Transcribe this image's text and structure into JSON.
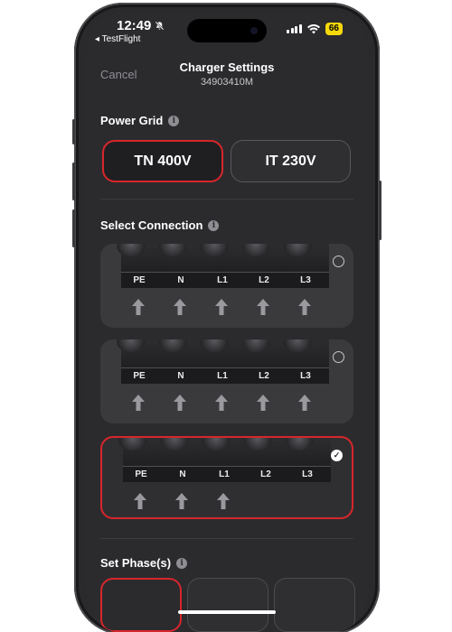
{
  "status_bar": {
    "time": "12:49",
    "mute_icon": "bell-slash-icon",
    "back_app": "◂ TestFlight",
    "battery": "66",
    "battery_color": "#f5d90a"
  },
  "header": {
    "cancel_label": "Cancel",
    "title": "Charger Settings",
    "subtitle": "34903410M"
  },
  "power_grid": {
    "label": "Power Grid",
    "options": [
      {
        "label": "TN 400V",
        "selected": true
      },
      {
        "label": "IT 230V",
        "selected": false
      }
    ]
  },
  "select_connection": {
    "label": "Select Connection",
    "terminals": [
      "PE",
      "N",
      "L1",
      "L2",
      "L3"
    ],
    "options": [
      {
        "arrows": 5,
        "selected": false
      },
      {
        "arrows": 5,
        "selected": false
      },
      {
        "arrows": 3,
        "selected": true
      }
    ]
  },
  "set_phases": {
    "label": "Set Phase(s)"
  },
  "colors": {
    "accent": "#d7262b",
    "background": "#2b2b2e",
    "card": "#3a3a3d"
  }
}
